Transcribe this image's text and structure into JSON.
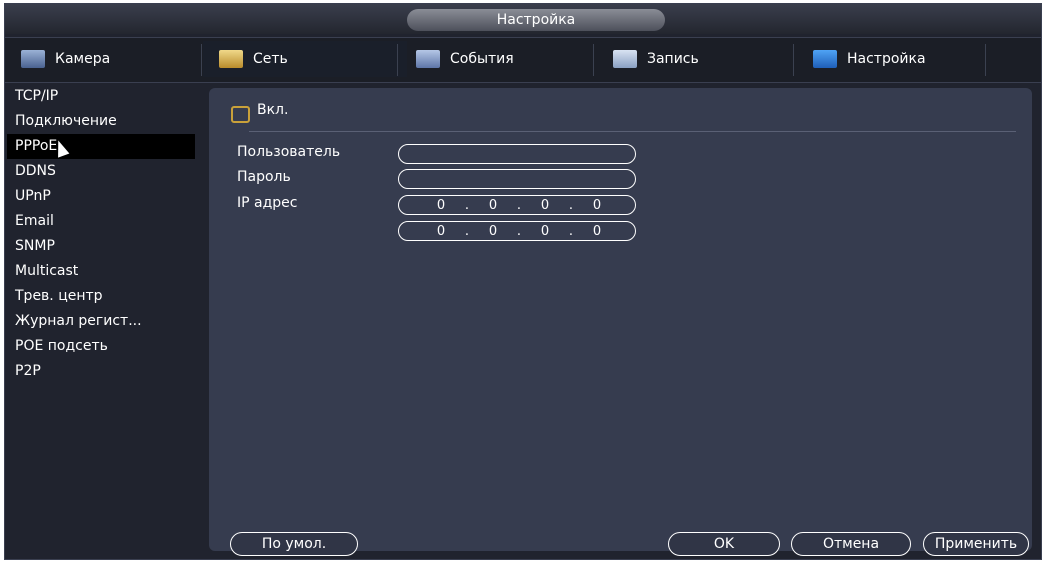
{
  "title": "Настройка",
  "tabs": [
    {
      "label": "Камера",
      "icon": "camera-icon"
    },
    {
      "label": "Сеть",
      "icon": "network-icon"
    },
    {
      "label": "События",
      "icon": "events-icon"
    },
    {
      "label": "Запись",
      "icon": "record-icon"
    },
    {
      "label": "Настройка",
      "icon": "settings-icon"
    }
  ],
  "active_tab": "Сеть",
  "sidebar": {
    "items": [
      "TCP/IP",
      "Подключение",
      "PPPoE",
      "DDNS",
      "UPnP",
      "Email",
      "SNMP",
      "Multicast",
      "Трев. центр",
      "Журнал регист...",
      "POE подсеть",
      "P2P"
    ],
    "selected": "PPPoE"
  },
  "form": {
    "enable_label": "Вкл.",
    "user_label": "Пользователь",
    "user_value": "",
    "password_label": "Пароль",
    "password_value": "",
    "ip_label": "IP адрес",
    "ip1": [
      "0",
      "0",
      "0",
      "0"
    ],
    "ip2": [
      "0",
      "0",
      "0",
      "0"
    ]
  },
  "buttons": {
    "default": "По умол.",
    "ok": "OK",
    "cancel": "Отмена",
    "apply": "Применить"
  },
  "colors": {
    "accent_checkbox": "#c9a13a",
    "panel": "#363c4f",
    "background": "#20232e"
  }
}
